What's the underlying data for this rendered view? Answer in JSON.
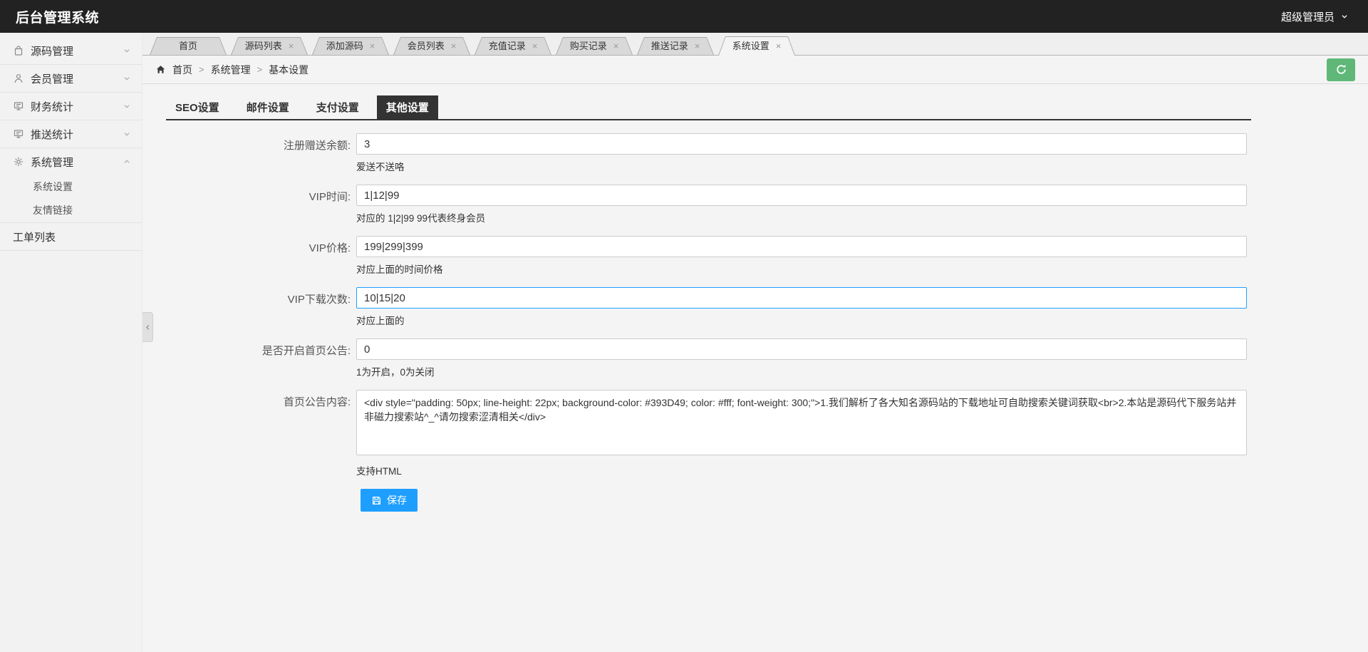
{
  "topbar": {
    "title": "后台管理系统",
    "user": "超级管理员"
  },
  "sidebar": {
    "items": [
      {
        "label": "源码管理",
        "icon": "bag-icon",
        "expandable": true,
        "expanded": false
      },
      {
        "label": "会员管理",
        "icon": "user-icon",
        "expandable": true,
        "expanded": false
      },
      {
        "label": "财务统计",
        "icon": "report-icon",
        "expandable": true,
        "expanded": false
      },
      {
        "label": "推送统计",
        "icon": "report-icon",
        "expandable": true,
        "expanded": false
      },
      {
        "label": "系统管理",
        "icon": "gear-icon",
        "expandable": true,
        "expanded": true,
        "children": [
          "系统设置",
          "友情链接"
        ]
      },
      {
        "label": "工单列表",
        "expandable": false
      }
    ]
  },
  "tabs": {
    "active": "系统设置",
    "items": [
      {
        "label": "首页",
        "closable": false
      },
      {
        "label": "源码列表",
        "closable": true
      },
      {
        "label": "添加源码",
        "closable": true
      },
      {
        "label": "会员列表",
        "closable": true
      },
      {
        "label": "充值记录",
        "closable": true
      },
      {
        "label": "购买记录",
        "closable": true
      },
      {
        "label": "推送记录",
        "closable": true
      },
      {
        "label": "系统设置",
        "closable": true
      }
    ]
  },
  "breadcrumb": {
    "separator": ">",
    "items": [
      "首页",
      "系统管理",
      "基本设置"
    ]
  },
  "settings_tabs": {
    "active": "其他设置",
    "items": [
      "SEO设置",
      "邮件设置",
      "支付设置",
      "其他设置"
    ]
  },
  "form": {
    "fields": [
      {
        "label": "注册赠送余额:",
        "value": "3",
        "hint": "爱送不送咯",
        "type": "input",
        "focused": false
      },
      {
        "label": "VIP时间:",
        "value": "1|12|99",
        "hint": "对应的 1|2|99 99代表终身会员",
        "type": "input",
        "focused": false
      },
      {
        "label": "VIP价格:",
        "value": "199|299|399",
        "hint": "对应上面的时间价格",
        "type": "input",
        "focused": false
      },
      {
        "label": "VIP下载次数:",
        "value": "10|15|20",
        "hint": "对应上面的",
        "type": "input",
        "focused": true
      },
      {
        "label": "是否开启首页公告:",
        "value": "0",
        "hint": "1为开启，0为关闭",
        "type": "input",
        "focused": false
      },
      {
        "label": "首页公告内容:",
        "value": "<div style=\"padding: 50px; line-height: 22px; background-color: #393D49; color: #fff; font-weight: 300;\">1.我们解析了各大知名源码站的下载地址可自助搜索关键词获取<br>2.本站是源码代下服务站并非磁力搜索站^_^请勿搜索涩清相关</div>",
        "hint": "支持HTML",
        "type": "textarea",
        "focused": false
      }
    ],
    "save_label": "保存"
  },
  "colors": {
    "topbar_bg": "#222222",
    "accent_blue": "#1E9FFF",
    "success_green": "#5FB878",
    "subtab_active_bg": "#333333"
  }
}
